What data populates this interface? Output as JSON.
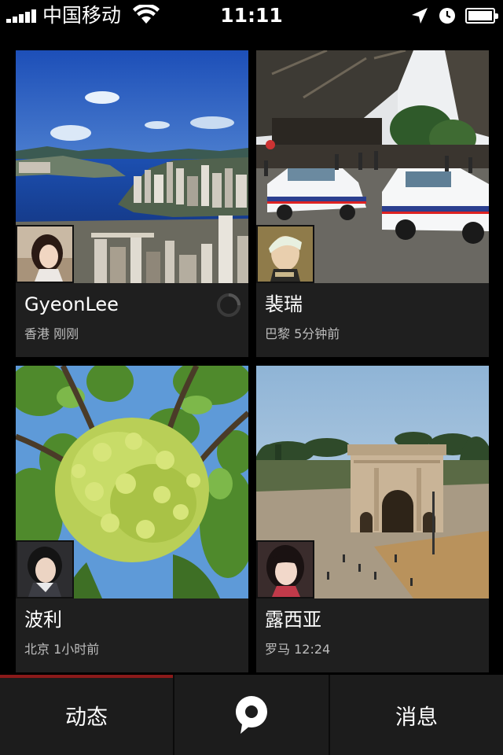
{
  "status_bar": {
    "carrier": "中国移动",
    "time": "11:11",
    "icons": [
      "signal-icon",
      "wifi-icon",
      "location-arrow-icon",
      "alarm-clock-icon",
      "battery-icon"
    ]
  },
  "feed": {
    "posts": [
      {
        "name": "GyeonLee",
        "location": "香港",
        "time": "刚刚",
        "meta": "香港 刚刚",
        "photo": "hong-kong-harbor-photo",
        "loading": true
      },
      {
        "name": "裴瑞",
        "location": "巴黎",
        "time": "5分钟前",
        "meta": "巴黎 5分钟前",
        "photo": "paris-police-cars-photo",
        "loading": false
      },
      {
        "name": "波利",
        "location": "北京",
        "time": "1小时前",
        "meta": "北京 1小时前",
        "photo": "green-flower-photo",
        "loading": false
      },
      {
        "name": "露西亚",
        "location": "罗马",
        "time": "12:24",
        "meta": "罗马 12:24",
        "photo": "rome-arch-photo",
        "loading": false
      }
    ]
  },
  "tab_bar": {
    "left_label": "动态",
    "center_icon": "location-pin-icon",
    "right_label": "消息",
    "active": "left"
  },
  "colors": {
    "background": "#000000",
    "card": "#1f1f1f",
    "tab_bar": "#1c1c1c",
    "active_indicator": "#8b1a1a",
    "meta_text": "#bdbdbd"
  }
}
